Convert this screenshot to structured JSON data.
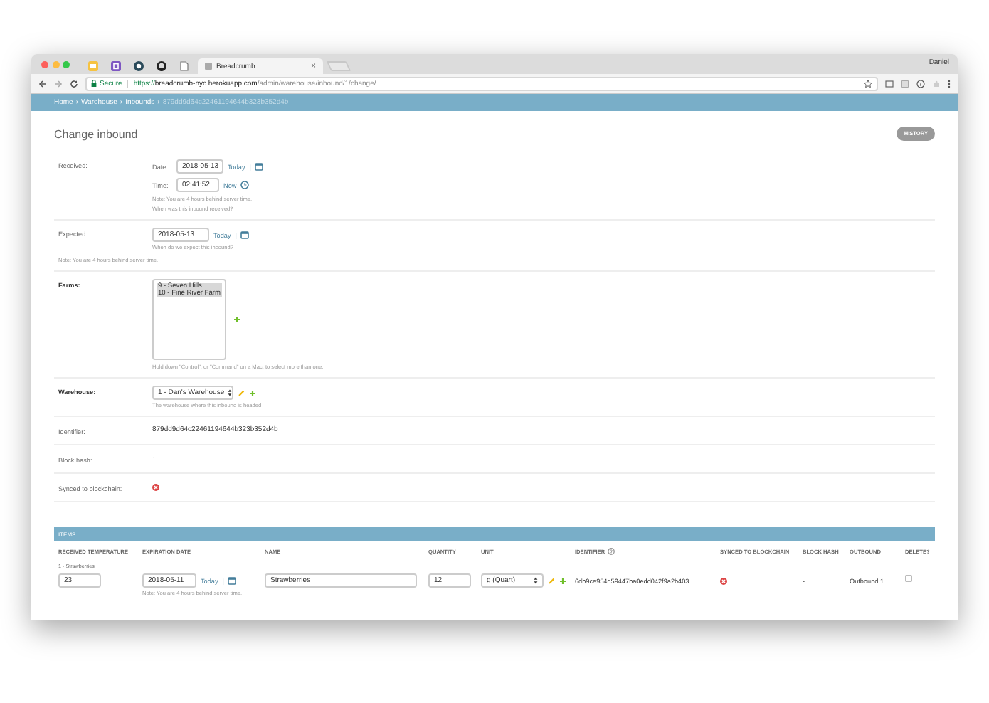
{
  "browser": {
    "profile": "Daniel",
    "tabs": [
      {
        "title": "Breadcrumb",
        "selected": true,
        "close": "×"
      }
    ],
    "address": {
      "secure": "Secure",
      "scheme": "https://",
      "host": "breadcrumb-nyc.herokuapp.com",
      "path": "/admin/warehouse/inbound/1/change/"
    }
  },
  "breadcrumbs": {
    "separator": "›",
    "items": [
      {
        "label": "Home",
        "link": true
      },
      {
        "label": "Warehouse",
        "link": true
      },
      {
        "label": "Inbounds",
        "link": true
      },
      {
        "label": "879dd9d64c22461194644b323b352d4b",
        "link": false
      }
    ]
  },
  "header": {
    "title": "Change inbound",
    "history": "HISTORY"
  },
  "received": {
    "label": "Received:",
    "date_label": "Date:",
    "date": "2018-05-13",
    "today": "Today",
    "today_sep": "|",
    "time_label": "Time:",
    "time": "02:41:52",
    "now": "Now",
    "note": "Note: You are 4 hours behind server time.",
    "help": "When was this inbound received?"
  },
  "expected": {
    "label": "Expected:",
    "date": "2018-05-13",
    "today": "Today",
    "today_sep": "|",
    "help": "When do we expect this inbound?"
  },
  "expected_note": "Note: You are 4 hours behind server time.",
  "farms": {
    "label": "Farms:",
    "required": true,
    "options": [
      {
        "label": "9 - Seven Hills",
        "selected": true
      },
      {
        "label": "10 - Fine River Farm",
        "selected": true
      }
    ],
    "help": "Hold down \"Control\", or \"Command\" on a Mac, to select more than one."
  },
  "warehouse": {
    "label": "Warehouse:",
    "required": true,
    "value": "1 - Dan's Warehouse",
    "help": "The warehouse where this inbound is headed"
  },
  "readonly": [
    {
      "label": "Identifier:",
      "kind": "text",
      "value": "879dd9d64c22461194644b323b352d4b"
    },
    {
      "label": "Block hash:",
      "kind": "text",
      "value": "-"
    },
    {
      "label": "Synced to blockchain:",
      "kind": "boolean",
      "checked": false
    }
  ],
  "items": {
    "title": "ITEMS",
    "columns": [
      {
        "label": "RECEIVED TEMPERATURE",
        "kind": "plain"
      },
      {
        "label": "EXPIRATION DATE",
        "kind": "plain"
      },
      {
        "label": "NAME",
        "kind": "plain"
      },
      {
        "label": "QUANTITY",
        "kind": "plain"
      },
      {
        "label": "UNIT",
        "kind": "plain"
      },
      {
        "label": "IDENTIFIER",
        "kind": "help"
      },
      {
        "label": "SYNCED TO BLOCKCHAIN",
        "kind": "plain"
      },
      {
        "label": "BLOCK HASH",
        "kind": "plain"
      },
      {
        "label": "OUTBOUND",
        "kind": "plain"
      },
      {
        "label": "DELETE?",
        "kind": "plain"
      }
    ],
    "rows": [
      {
        "label": "1 - Strawberries",
        "temperature": "23",
        "expiration": "2018-05-11",
        "today": "Today",
        "today_sep": "|",
        "note": "Note: You are 4 hours behind server time.",
        "name": "Strawberries",
        "quantity": "12",
        "unit": "g (Quart)",
        "identifier": "6db9ce954d59447ba0edd042f9a2b403",
        "synced": false,
        "block_hash": "-",
        "outbound": "Outbound 1",
        "delete": false
      }
    ]
  }
}
